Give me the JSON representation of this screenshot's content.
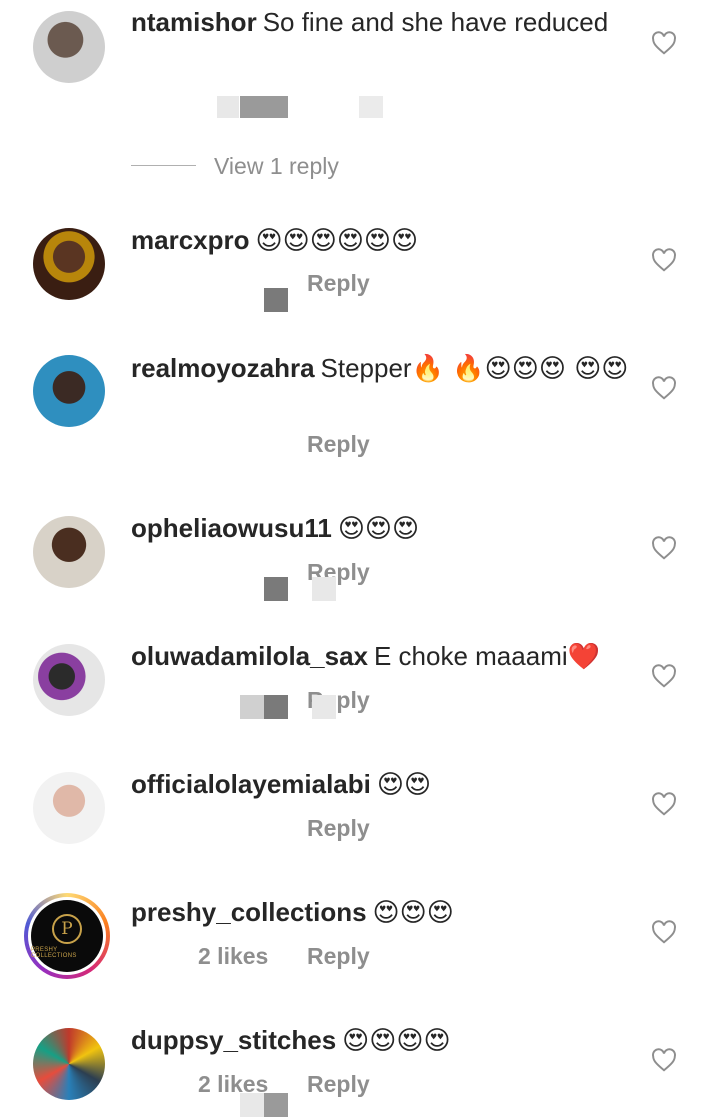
{
  "comments": [
    {
      "username": "ntamishor",
      "text": "So fine and she have reduced",
      "emojis": "",
      "meta": {
        "time": "",
        "likes": "",
        "reply": ""
      },
      "view_replies": "View 1 reply",
      "avatar_icon": "user-photo",
      "like_icon": "heart-outline-icon"
    },
    {
      "username": "marcxpro",
      "text": "",
      "emojis": "😍😍😍😍😍😍",
      "meta": {
        "time": "",
        "likes": "",
        "reply": "Reply"
      },
      "avatar_icon": "user-photo",
      "like_icon": "heart-outline-icon"
    },
    {
      "username": "realmoyozahra",
      "text": "Stepper",
      "emojis": "🔥 🔥😍😍😍 😍😍",
      "meta": {
        "time": "",
        "likes": "",
        "reply": "Reply"
      },
      "avatar_icon": "user-photo",
      "like_icon": "heart-outline-icon"
    },
    {
      "username": "opheliaowusu11",
      "text": "",
      "emojis": "😍😍😍",
      "meta": {
        "time": "",
        "likes": "",
        "reply": "Reply"
      },
      "avatar_icon": "user-photo",
      "like_icon": "heart-outline-icon"
    },
    {
      "username": "oluwadamilola_sax",
      "text": "E choke maaami",
      "emojis": "❤️",
      "meta": {
        "time": "",
        "likes": "",
        "reply": "Reply"
      },
      "avatar_icon": "user-photo",
      "like_icon": "heart-outline-icon"
    },
    {
      "username": "officialolayemialabi",
      "text": "",
      "emojis": "😍😍",
      "meta": {
        "time": "",
        "likes": "",
        "reply": "Reply"
      },
      "avatar_icon": "user-photo",
      "like_icon": "heart-outline-icon"
    },
    {
      "username": "preshy_collections",
      "text": "",
      "emojis": "😍😍😍",
      "meta": {
        "time": "",
        "likes": "2 likes",
        "reply": "Reply"
      },
      "avatar_icon": "brand-logo",
      "avatar_logo_letter": "P",
      "avatar_logo_text": "PRESHY COLLECTIONS",
      "like_icon": "heart-outline-icon"
    },
    {
      "username": "duppsy_stitches",
      "text": "",
      "emojis": "😍😍😍😍",
      "meta": {
        "time": "",
        "likes": "2 likes",
        "reply": "Reply"
      },
      "avatar_icon": "user-photo",
      "like_icon": "heart-outline-icon"
    }
  ],
  "colors": {
    "username": "#262626",
    "meta": "#8e8e8e",
    "heart_outline": "#8e8e8e",
    "story_ring": "#d62976"
  }
}
